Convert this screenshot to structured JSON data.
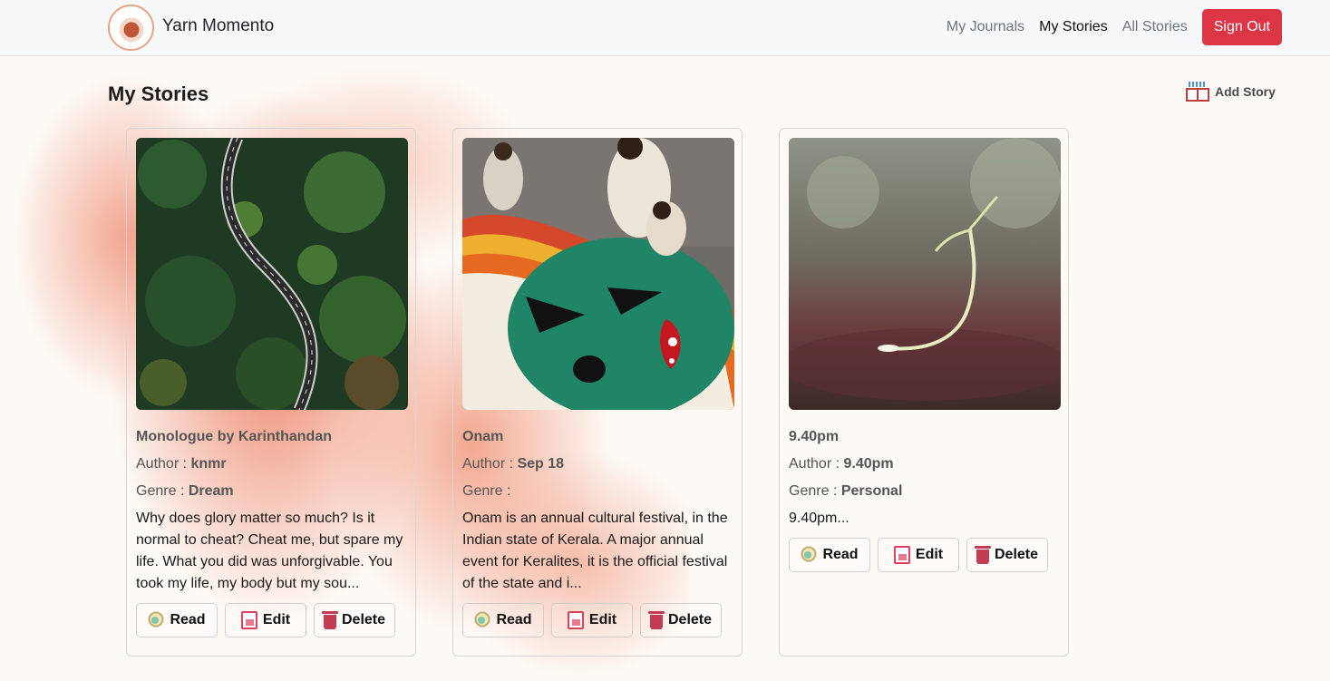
{
  "navbar": {
    "brand": "Yarn Momento",
    "links": [
      "My Journals",
      "My Stories",
      "All Stories"
    ],
    "active": "My Stories",
    "sign_out": "Sign Out"
  },
  "page": {
    "title": "My Stories",
    "add_story": "Add Story"
  },
  "labels": {
    "author": "Author : ",
    "genre": "Genre : ",
    "read": "Read",
    "edit": "Edit",
    "delete": "Delete"
  },
  "stories": [
    {
      "title": "Monologue by Karinthandan",
      "author": "knmr",
      "genre": "Dream",
      "excerpt": "Why does glory matter so much? Is it normal to cheat? Cheat me, but spare my life. What you did was unforgivable. You took my life, my body but my sou...",
      "image": "aerial-forest-road"
    },
    {
      "title": "Onam",
      "author": "Sep 18",
      "genre": "",
      "excerpt": "Onam is an annual cultural festival, in the Indian state of Kerala. A major annual event for Keralites, it is the official festival of the state and i...",
      "image": "onam-rangoli"
    },
    {
      "title": "9.40pm",
      "author": "9.40pm",
      "genre": "Personal",
      "excerpt": "9.40pm...",
      "image": "seedling-sprout"
    }
  ],
  "colors": {
    "signout_bg": "#dc3545",
    "splash": "#ec785a"
  }
}
